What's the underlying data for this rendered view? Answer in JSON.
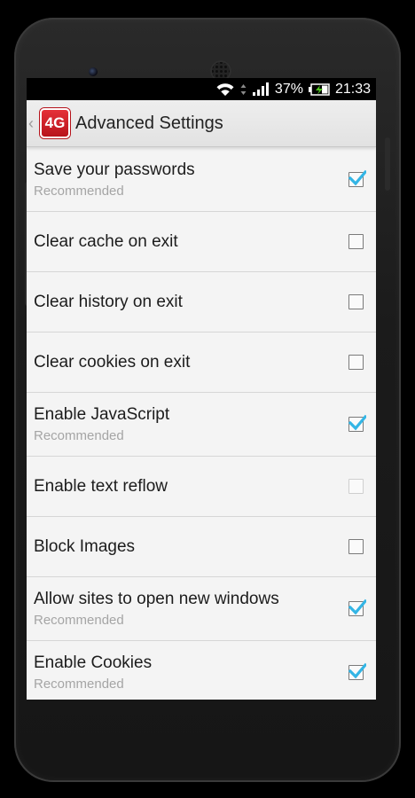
{
  "status_bar": {
    "battery": "37%",
    "time": "21:33"
  },
  "action_bar": {
    "logo_text": "4G",
    "title": "Advanced Settings"
  },
  "accent_color": "#33b5e5",
  "settings": [
    {
      "label": "Save your passwords",
      "summary": "Recommended",
      "checked": true
    },
    {
      "label": "Clear cache on exit",
      "summary": "",
      "checked": false
    },
    {
      "label": "Clear history on exit",
      "summary": "",
      "checked": false
    },
    {
      "label": "Clear cookies on exit",
      "summary": "",
      "checked": false
    },
    {
      "label": "Enable JavaScript",
      "summary": "Recommended",
      "checked": true
    },
    {
      "label": "Enable text reflow",
      "summary": "",
      "checked": false,
      "disabled": true
    },
    {
      "label": "Block Images",
      "summary": "",
      "checked": false
    },
    {
      "label": "Allow sites to open new windows",
      "summary": "Recommended",
      "checked": true
    },
    {
      "label": "Enable Cookies",
      "summary": "Recommended",
      "checked": true
    }
  ]
}
